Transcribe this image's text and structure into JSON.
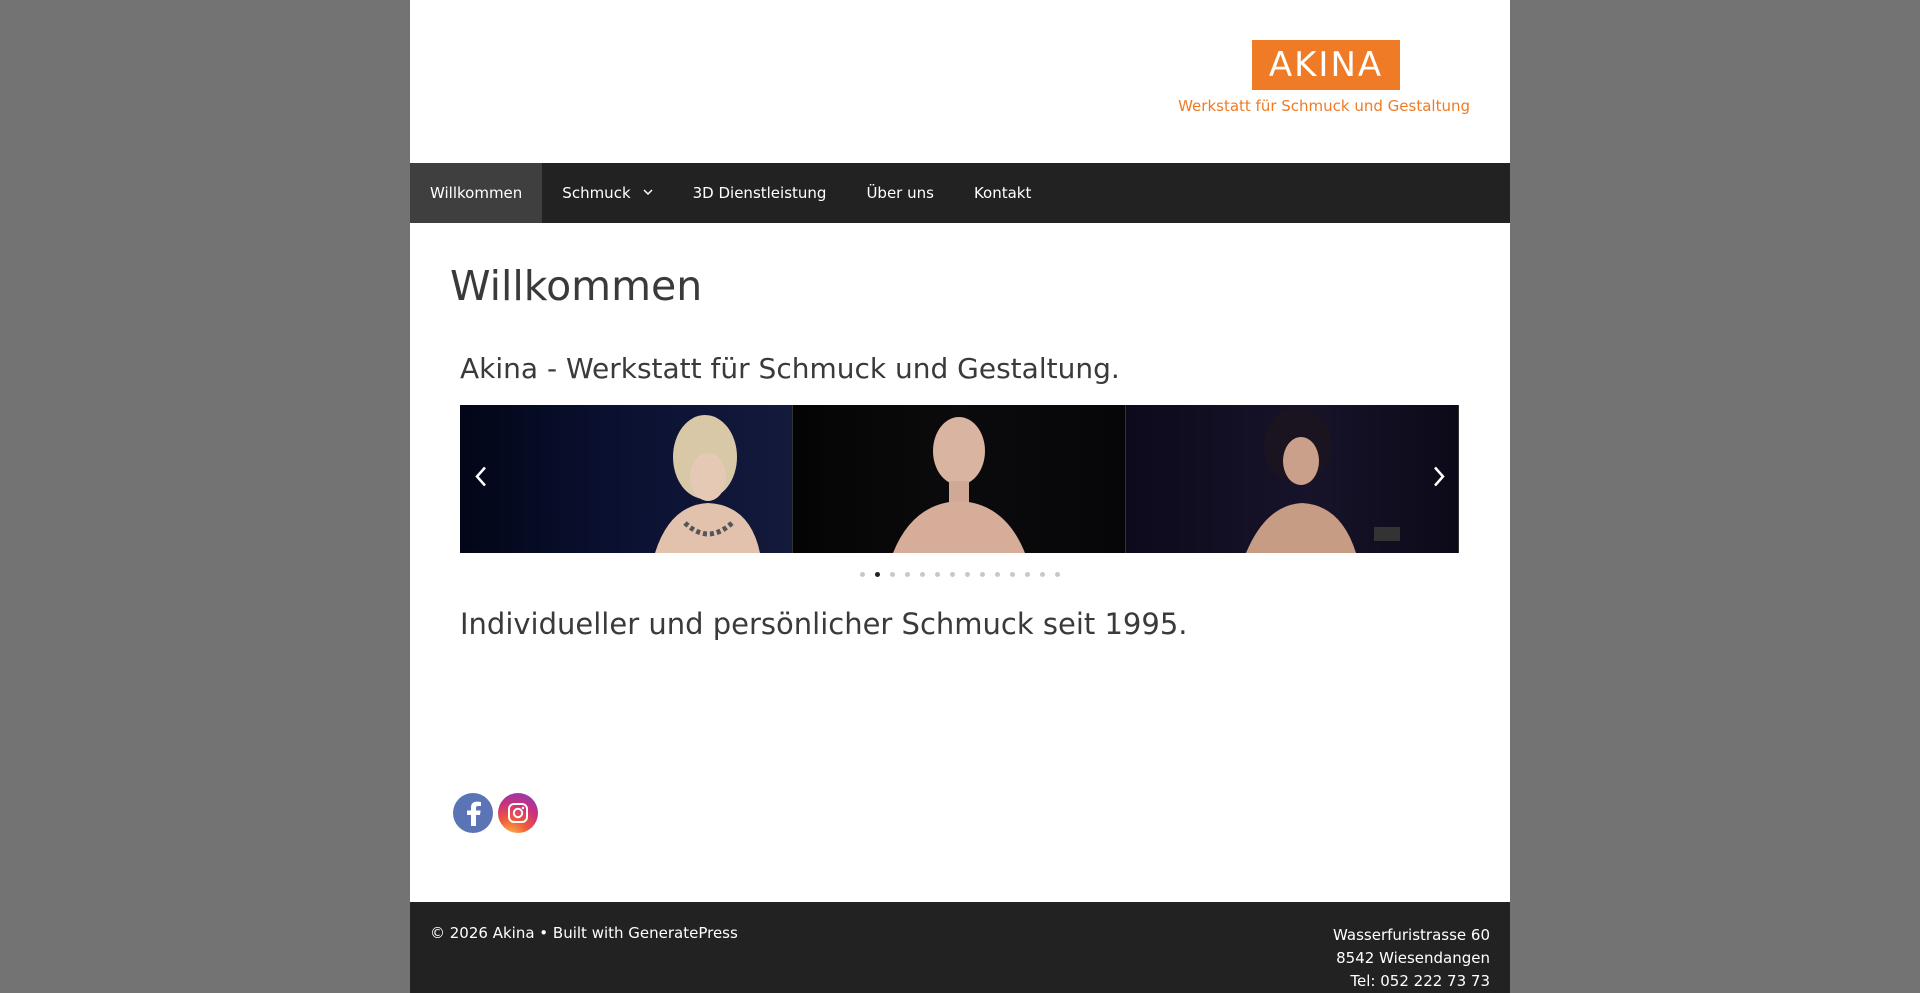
{
  "header": {
    "logo_text": "AKINA",
    "logo_tagline": "Werkstatt für Schmuck und Gestaltung",
    "brand_color": "#ef7b26"
  },
  "nav": {
    "items": [
      {
        "label": "Willkommen",
        "active": true
      },
      {
        "label": "Schmuck",
        "has_dropdown": true
      },
      {
        "label": "3D Dienstleistung"
      },
      {
        "label": "Über uns"
      },
      {
        "label": "Kontakt"
      }
    ],
    "dropdown_icon": "chevron-down-icon"
  },
  "main": {
    "title": "Willkommen",
    "subtitle": "Akina - Werkstatt für Schmuck und Gestaltung.",
    "slider": {
      "prev_icon": "chevron-left-icon",
      "next_icon": "chevron-right-icon",
      "dot_count": 14,
      "active_dot": 2
    },
    "tagline": "Individueller und persönlicher Schmuck seit 1995."
  },
  "social": {
    "facebook_icon": "facebook-icon",
    "instagram_icon": "instagram-icon"
  },
  "footer": {
    "copyright": "© 2026 Akina • Built with GeneratePress",
    "address_line1": "Wasserfuristrasse 60",
    "address_line2": "8542 Wiesendangen",
    "phone": "Tel: 052 222 73 73"
  }
}
